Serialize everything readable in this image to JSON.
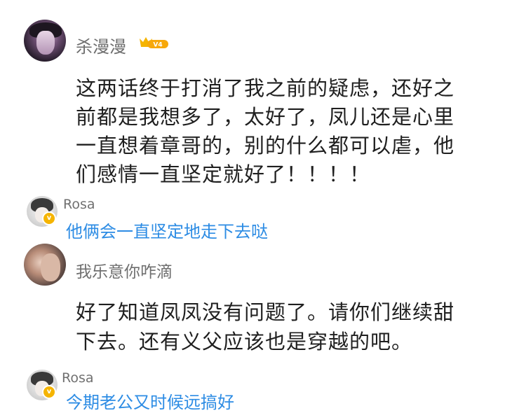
{
  "comments": [
    {
      "author": "杀漫漫",
      "level_badge": "V4",
      "text_lines": [
        "这两话终于打消了我之前的疑虑，还好之",
        "前都是我想多了，太好了，凤儿还是心里",
        "一直想着章哥的，别的什么都可以虐，他",
        "们感情一直坚定就好了！！！！"
      ],
      "reply": {
        "author": "Rosa",
        "text": "他俩会一直坚定地走下去哒"
      }
    },
    {
      "author": "我乐意你咋滴",
      "text_lines": [
        "好了知道凤凤没有问题了。请你们继续甜",
        "下去。还有义父应该也是穿越的吧。"
      ],
      "reply": {
        "author": "Rosa",
        "text": "今期老公又时候远搞好"
      }
    }
  ],
  "colors": {
    "reply_text": "#2d8ce4",
    "username": "#6f6f6f",
    "body_text": "#1f1f1f",
    "badge": "#f5b400"
  }
}
